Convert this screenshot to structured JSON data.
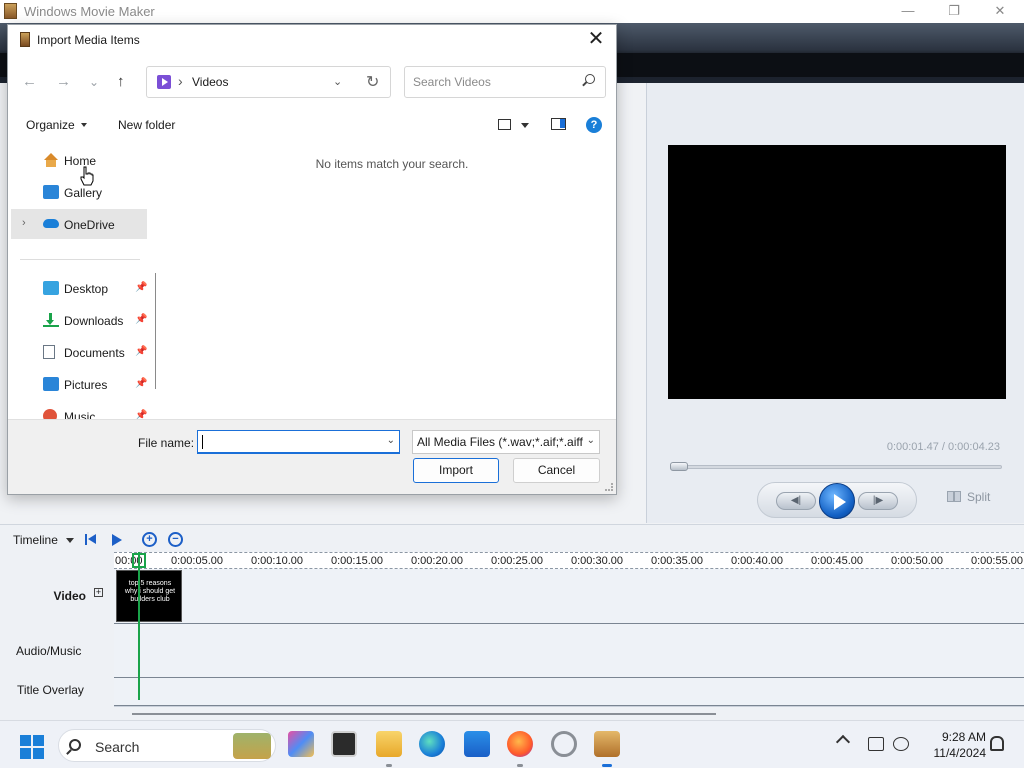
{
  "app": {
    "title": "Windows Movie Maker",
    "window_controls": {
      "minimize": "—",
      "maximize": "❐",
      "close": "✕"
    }
  },
  "preview": {
    "time": "0:00:01.47 / 0:00:04.23",
    "split_label": "Split",
    "prev_glyph": "◀|",
    "next_glyph": "|▶",
    "seek_position_fraction": 0.35
  },
  "timeline": {
    "label": "Timeline",
    "ruler": [
      "00:00",
      "0:00:05.00",
      "0:00:10.00",
      "0:00:15.00",
      "0:00:20.00",
      "0:00:25.00",
      "0:00:30.00",
      "0:00:35.00",
      "0:00:40.00",
      "0:00:45.00",
      "0:00:50.00",
      "0:00:55.00"
    ],
    "tracks": {
      "video": "Video",
      "audio": "Audio/Music",
      "title": "Title Overlay"
    },
    "clip_text": "top 5 reasons why i should get builders club",
    "expand_glyph": "+",
    "zoom_in": "+",
    "zoom_out": "−"
  },
  "dialog": {
    "title": "Import Media Items",
    "close_glyph": "✕",
    "nav": {
      "back": "←",
      "forward": "→",
      "recent": "⌄",
      "up": "↑"
    },
    "address": {
      "separator": "›",
      "path": "Videos",
      "dropdown": "⌄",
      "refresh": "↻"
    },
    "search_placeholder": "Search Videos",
    "toolbar": {
      "organize": "Organize",
      "new_folder": "New folder",
      "help": "?"
    },
    "nav_pane": {
      "quick": [
        {
          "label": "Home",
          "icon": "home-icon"
        },
        {
          "label": "Gallery",
          "icon": "gallery-icon"
        },
        {
          "label": "OneDrive",
          "icon": "onedrive-icon",
          "selected": true
        }
      ],
      "pinned": [
        {
          "label": "Desktop",
          "icon": "desktop-icon"
        },
        {
          "label": "Downloads",
          "icon": "downloads-icon"
        },
        {
          "label": "Documents",
          "icon": "documents-icon"
        },
        {
          "label": "Pictures",
          "icon": "pictures-icon"
        },
        {
          "label": "Music",
          "icon": "music-icon"
        }
      ],
      "expand_glyph": "›",
      "pin_glyph": "📌"
    },
    "empty_message": "No items match your search.",
    "file_name_label": "File name:",
    "file_name_value": "",
    "file_type": "All Media Files (*.wav;*.aif;*.aiff",
    "dropdown_glyph": "⌄",
    "import_label": "Import",
    "cancel_label": "Cancel"
  },
  "taskbar": {
    "search_label": "Search",
    "time": "9:28 AM",
    "date": "11/4/2024",
    "apps": [
      "copilot-icon",
      "terminal-icon",
      "file-explorer-icon",
      "edge-icon",
      "store-icon",
      "firefox-icon",
      "sync-icon",
      "movie-maker-icon"
    ],
    "colors": {
      "accent": "#1a6fd8"
    }
  }
}
